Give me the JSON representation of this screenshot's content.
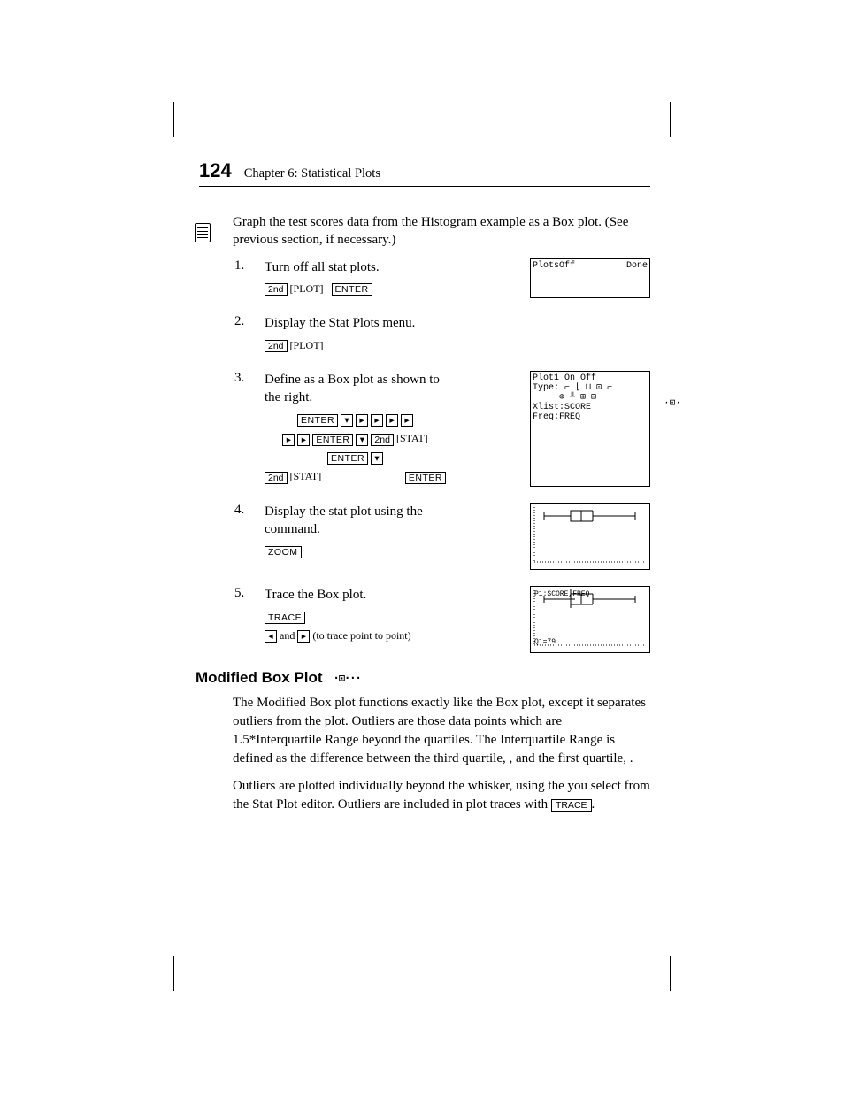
{
  "header": {
    "page_number": "124",
    "chapter": "Chapter 6: Statistical Plots"
  },
  "intro": "Graph the test scores data from the Histogram example as a Box plot. (See previous section, if necessary.)",
  "keys": {
    "second": "2nd",
    "plot": "PLOT",
    "enter": "ENTER",
    "stat": "STAT",
    "zoom": "ZOOM",
    "trace": "TRACE"
  },
  "steps": [
    {
      "num": "1.",
      "text": "Turn off all stat plots.",
      "lcd_left": "PlotsOff",
      "lcd_right": "Done"
    },
    {
      "num": "2.",
      "text": "Display the Stat Plots menu."
    },
    {
      "num": "3.",
      "text_a": "Define ",
      "text_b": " as a Box plot as shown to the right.",
      "lcd": {
        "l1": "Plot1 On Off",
        "l2": "Type:",
        "l3": "Xlist:SCORE",
        "l4": "Freq:FREQ"
      }
    },
    {
      "num": "4.",
      "text_a": "Display the stat plot using the ",
      "text_b": " command."
    },
    {
      "num": "5.",
      "text": "Trace the Box plot.",
      "sub_a": " and ",
      "sub_b": " (to trace point to point)",
      "lcd_top": "P1:SCORE,FREQ",
      "lcd_bot": "Q1=79"
    }
  ],
  "section": {
    "title": "Modified Box Plot"
  },
  "mod_para1": "The Modified Box plot functions exactly like the Box plot, except it separates outliers from the plot. Outliers are those data points which are 1.5*Interquartile Range beyond the quartiles. The Interquartile Range is defined as the difference between the third quartile,    , and the first quartile,    .",
  "mod_para2_a": "Outliers are plotted individually beyond the whisker, using the      you select from the Stat Plot editor. Outliers are included in plot traces with ",
  "mod_para2_b": "."
}
